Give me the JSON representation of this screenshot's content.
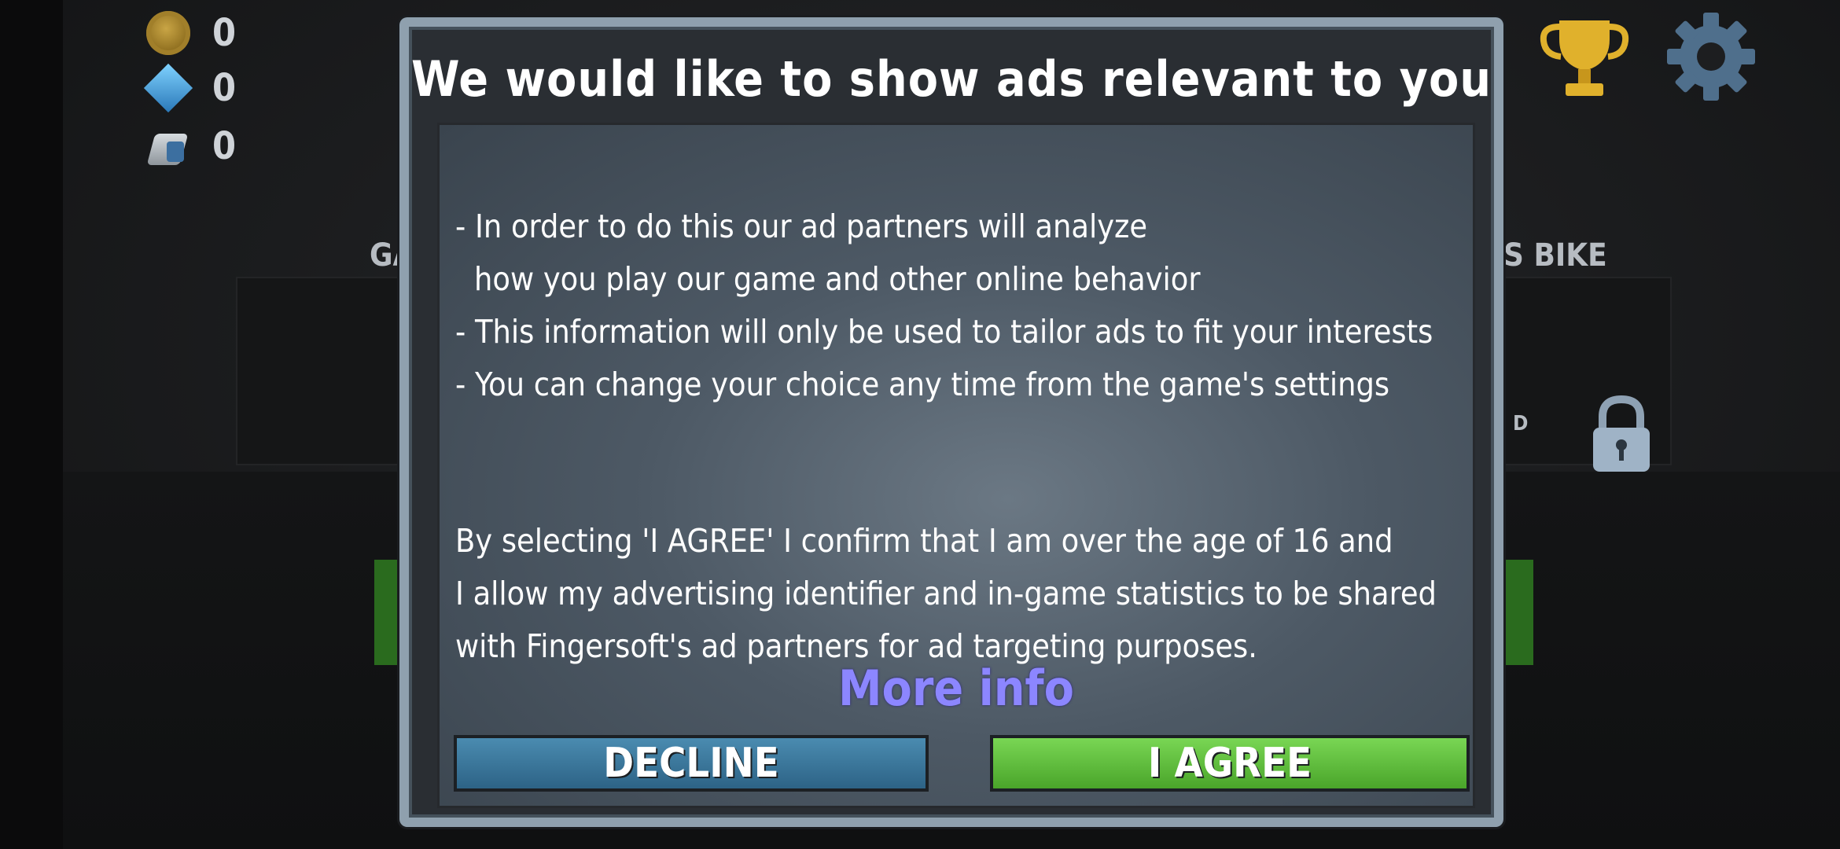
{
  "hud": {
    "coins": "0",
    "gems": "0",
    "fuel": "0"
  },
  "background": {
    "left_label": "GA",
    "right_label": "S BIKE",
    "right_card_text": "D"
  },
  "dialog": {
    "title": "We would like to show ads relevant to you",
    "bullets": [
      "- In order to do this our ad partners will analyze",
      "how you play our game and other online behavior",
      "- This information will only be used to tailor ads to fit your interests",
      "- You can change your choice any time from the game's settings"
    ],
    "consent_lines": [
      "By selecting 'I AGREE' I confirm that I am over the age of 16 and",
      "I allow my advertising identifier and in-game statistics to be shared",
      "with Fingersoft's ad partners for ad targeting purposes."
    ],
    "more_info": "More info",
    "decline_label": "DECLINE",
    "agree_label": "I AGREE"
  },
  "colors": {
    "decline": "#2d6386",
    "agree": "#4aa52a",
    "link": "#8c86ff"
  },
  "icons": [
    "coin-icon",
    "gem-icon",
    "fuel-icon",
    "trophy-icon",
    "gear-icon",
    "lock-icon"
  ]
}
